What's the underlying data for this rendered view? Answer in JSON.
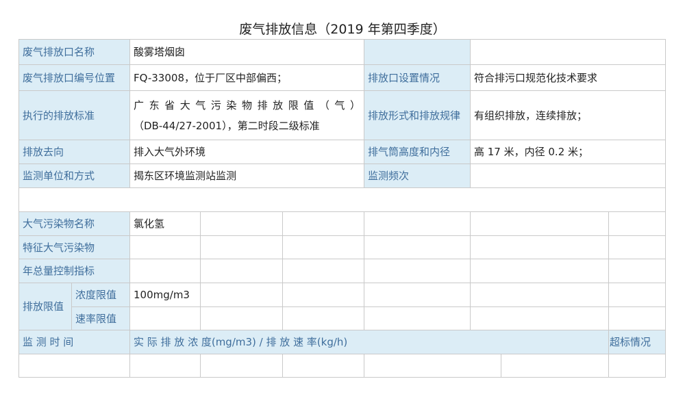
{
  "title": "废气排放信息（2019 年第四季度）",
  "info": {
    "outlet_name_label": "废气排放口名称",
    "outlet_name_value": "酸雾塔烟囱",
    "outlet_code_label": "废气排放口编号位置",
    "outlet_code_value": "FQ-33008，位于厂区中部偏西；",
    "outlet_setup_label": "排放口设置情况",
    "outlet_setup_value": "符合排污口规范化技术要求",
    "standard_label": "执行的排放标准",
    "standard_value_line1": "广东省大气污染物排放限值（气）",
    "standard_value_line2": "（DB-44/27-2001），第二时段二级标准",
    "discharge_form_label": "排放形式和排放规律",
    "discharge_form_value": "有组织排放，连续排放；",
    "destination_label": "排放去向",
    "destination_value": "排入大气外环境",
    "stack_label": "排气筒高度和内径",
    "stack_value": "高 17 米，内径 0.2 米；",
    "monitor_unit_label": "监测单位和方式",
    "monitor_unit_value": "揭东区环境监测站监测",
    "monitor_freq_label": "监测频次"
  },
  "pollutants": {
    "name_label": "大气污染物名称",
    "name_value": "氯化氢",
    "feature_label": "特征大气污染物",
    "annual_label": "年总量控制指标",
    "limit_label": "排放限值",
    "conc_label": "浓度限值",
    "conc_value": "100mg/m3",
    "rate_label": "速率限值"
  },
  "monitoring": {
    "time_label": "监 测 时 间",
    "actual_label": "实 际 排 放 浓 度(mg/m3) / 排 放 速 率(kg/h)",
    "exceed_label": "超标情况"
  }
}
